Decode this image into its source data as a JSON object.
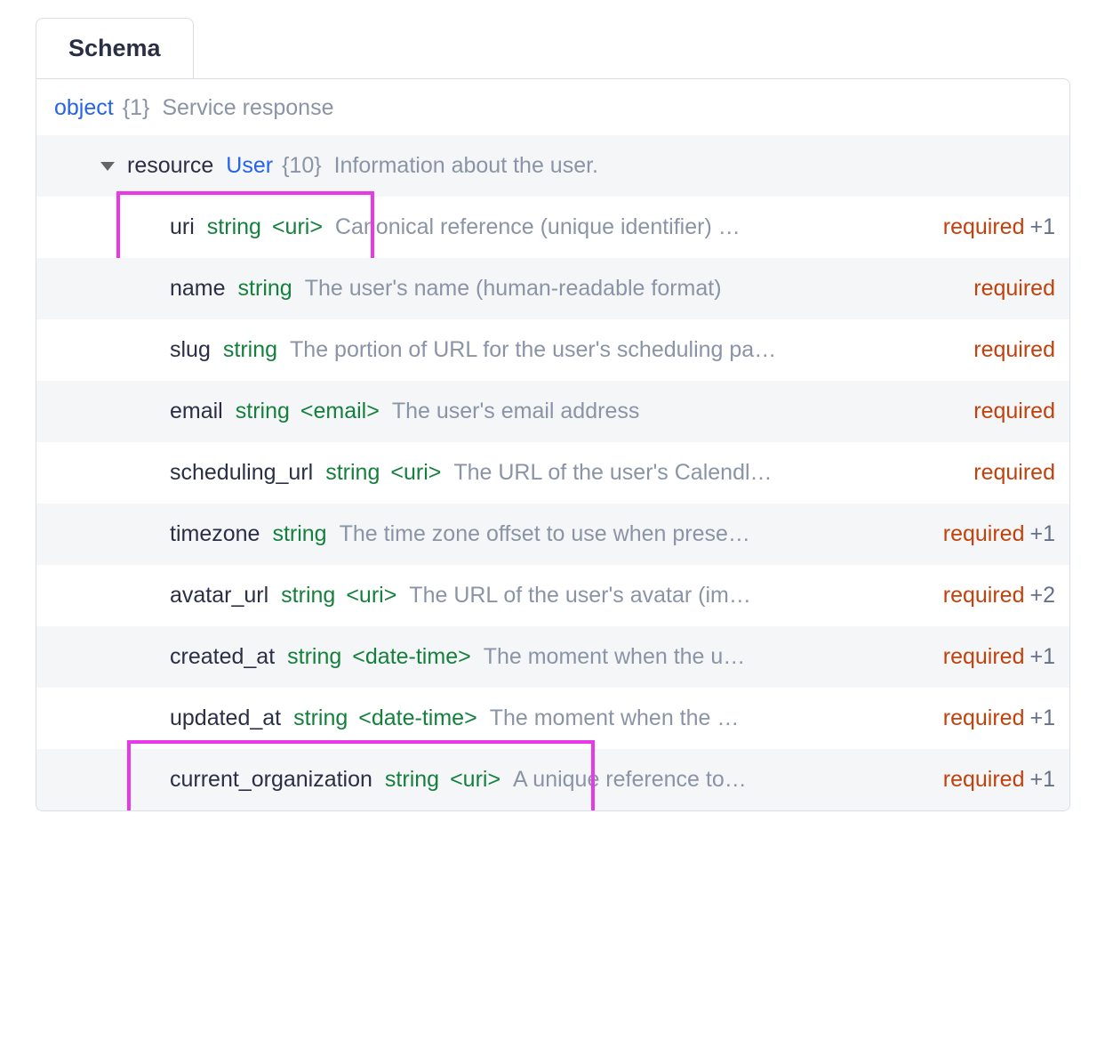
{
  "tab": {
    "label": "Schema"
  },
  "root": {
    "type": "object",
    "count": "{1}",
    "desc": "Service response"
  },
  "resource": {
    "name": "resource",
    "type": "User",
    "count": "{10}",
    "desc": "Information about the user."
  },
  "fields": [
    {
      "name": "uri",
      "type": "string",
      "format": "<uri>",
      "desc": "Canonical reference (unique identifier) …",
      "required": "required",
      "extra": "+1"
    },
    {
      "name": "name",
      "type": "string",
      "format": "",
      "desc": "The user's name (human-readable format)",
      "required": "required",
      "extra": ""
    },
    {
      "name": "slug",
      "type": "string",
      "format": "",
      "desc": "The portion of URL for the user's scheduling pa…",
      "required": "required",
      "extra": ""
    },
    {
      "name": "email",
      "type": "string",
      "format": "<email>",
      "desc": "The user's email address",
      "required": "required",
      "extra": ""
    },
    {
      "name": "scheduling_url",
      "type": "string",
      "format": "<uri>",
      "desc": "The URL of the user's Calendl…",
      "required": "required",
      "extra": ""
    },
    {
      "name": "timezone",
      "type": "string",
      "format": "",
      "desc": "The time zone offset to use when prese…",
      "required": "required",
      "extra": "+1"
    },
    {
      "name": "avatar_url",
      "type": "string",
      "format": "<uri>",
      "desc": "The URL of the user's avatar (im…",
      "required": "required",
      "extra": "+2"
    },
    {
      "name": "created_at",
      "type": "string",
      "format": "<date-time>",
      "desc": "The moment when the u…",
      "required": "required",
      "extra": "+1"
    },
    {
      "name": "updated_at",
      "type": "string",
      "format": "<date-time>",
      "desc": "The moment when the …",
      "required": "required",
      "extra": "+1"
    },
    {
      "name": "current_organization",
      "type": "string",
      "format": "<uri>",
      "desc": "A unique reference to…",
      "required": "required",
      "extra": "+1"
    }
  ]
}
